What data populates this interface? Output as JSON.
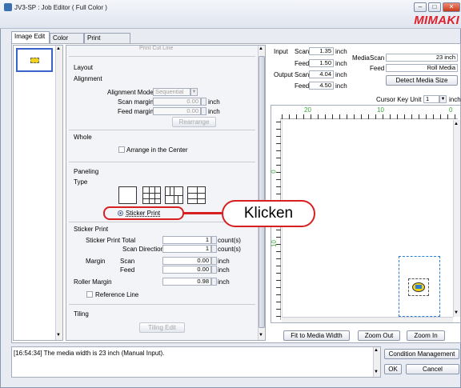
{
  "window": {
    "title": "JV3-SP : Job Editor ( Full Color )",
    "logo": "MIMAKI"
  },
  "tabs": [
    "Image Edit",
    "Color Edit",
    "Print Condition"
  ],
  "settings": {
    "top_cutoff": "Print Cut Line",
    "layout_title": "Layout",
    "alignment_title": "Alignment",
    "alignment_mode_label": "Alignment Mode",
    "alignment_mode_value": "Sequential",
    "scan_margin_label": "Scan margin",
    "scan_margin_value": "0.00",
    "feed_margin_label": "Feed margin",
    "feed_margin_value": "0.00",
    "unit_inch": "inch",
    "rearrange_button": "Rearrange",
    "whole_title": "Whole",
    "arrange_center_label": "Arrange in the Center",
    "paneling_title": "Paneling",
    "type_label": "Type",
    "sticker_print_radio": "Sticker Print",
    "sticker_print_title": "Sticker Print",
    "sticker_print_total_label": "Sticker Print Total",
    "sticker_print_total_value": "1",
    "scan_direction_label": "Scan Direction",
    "scan_direction_value": "1",
    "count_unit": "count(s)",
    "margin_label": "Margin",
    "margin_scan_label": "Scan",
    "margin_scan_value": "0.00",
    "margin_feed_label": "Feed",
    "margin_feed_value": "0.00",
    "roller_margin_label": "Roller Margin",
    "roller_margin_value": "0.98",
    "reference_line_label": "Reference Line",
    "tiling_title": "Tiling",
    "tiling_edit_button": "Tiling Edit"
  },
  "info": {
    "input_label": "Input",
    "output_label": "Output",
    "scan_label": "Scan",
    "feed_label": "Feed",
    "input_scan": "1.35",
    "input_feed": "1.50",
    "output_scan": "4.04",
    "output_feed": "4.50",
    "inch": "inch",
    "media_label": "Media",
    "media_scan_label": "Scan",
    "media_scan_value": "23 inch",
    "media_feed_label": "Feed",
    "media_feed_value": "Roll Media",
    "detect_media_button": "Detect Media Size",
    "cursor_key_unit_label": "Cursor Key Unit",
    "cursor_key_unit_value": "1",
    "cursor_key_unit_suffix": "inch"
  },
  "ruler": {
    "top_labels": [
      "20",
      "10",
      "0"
    ],
    "left_labels": [
      "0",
      "10"
    ]
  },
  "preview_buttons": {
    "fit": "Fit to Media Width",
    "zoom_out": "Zoom Out",
    "zoom_in": "Zoom In"
  },
  "log": {
    "message": "[16:54:34] The media width is 23 inch (Manual Input)."
  },
  "bottom_buttons": {
    "condition_management": "Condition Management",
    "ok": "OK",
    "cancel": "Cancel"
  },
  "annotation": {
    "callout": "Klicken"
  },
  "colors": {
    "accent_red": "#d82020",
    "preview_dash": "#2a7fd4",
    "ruler_green": "#3aa83a",
    "sticker_yellow": "#f2d21a"
  }
}
